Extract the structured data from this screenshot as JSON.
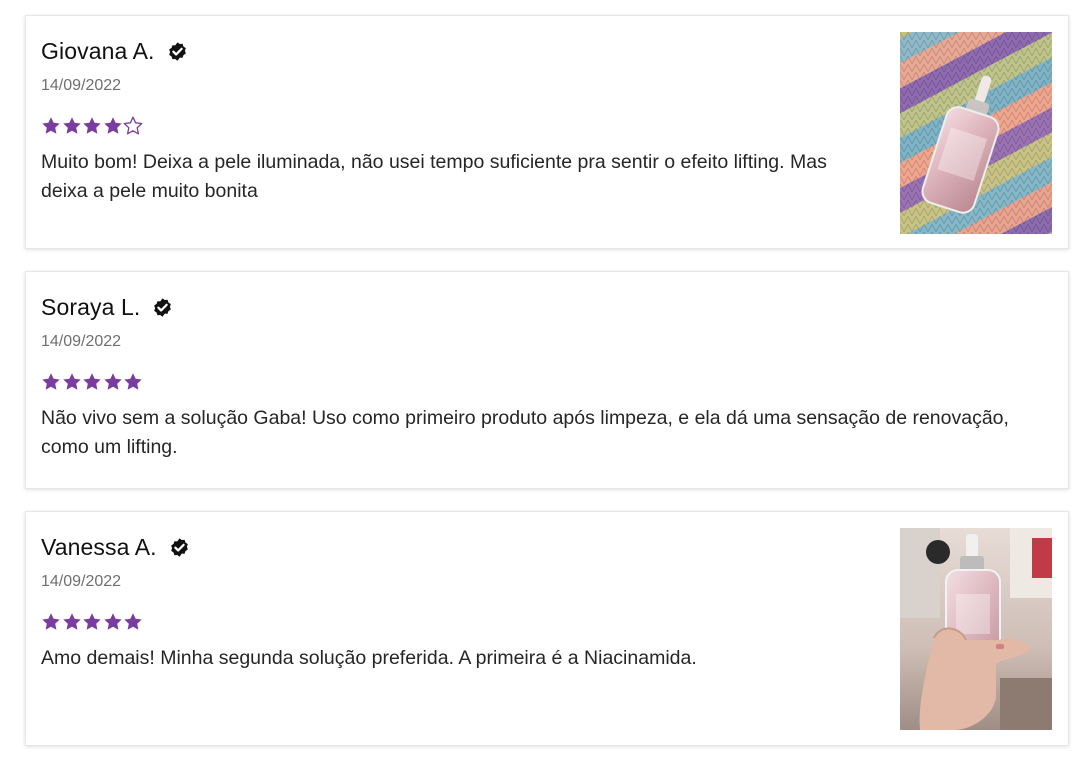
{
  "colors": {
    "star": "#7b3ca0",
    "icon": "#111111"
  },
  "reviews": [
    {
      "name": "Giovana A.",
      "date": "14/09/2022",
      "rating": 4,
      "max_rating": 5,
      "text": "Muito bom! Deixa a pele iluminada, não usei tempo suficiente pra sentir o efeito lifting. Mas deixa a pele muito bonita",
      "has_photo": true,
      "icon": "verified-check-icon"
    },
    {
      "name": "Soraya L.",
      "date": "14/09/2022",
      "rating": 5,
      "max_rating": 5,
      "text": "Não vivo sem a solução Gaba! Uso como primeiro produto após limpeza, e ela dá uma sensação de renovação, como um lifting.",
      "has_photo": false,
      "icon": "verified-check-icon"
    },
    {
      "name": "Vanessa A.",
      "date": "14/09/2022",
      "rating": 5,
      "max_rating": 5,
      "text": "Amo demais! Minha segunda solução preferida. A primeira é a Niacinamida.",
      "has_photo": true,
      "icon": "verified-check-icon"
    }
  ]
}
